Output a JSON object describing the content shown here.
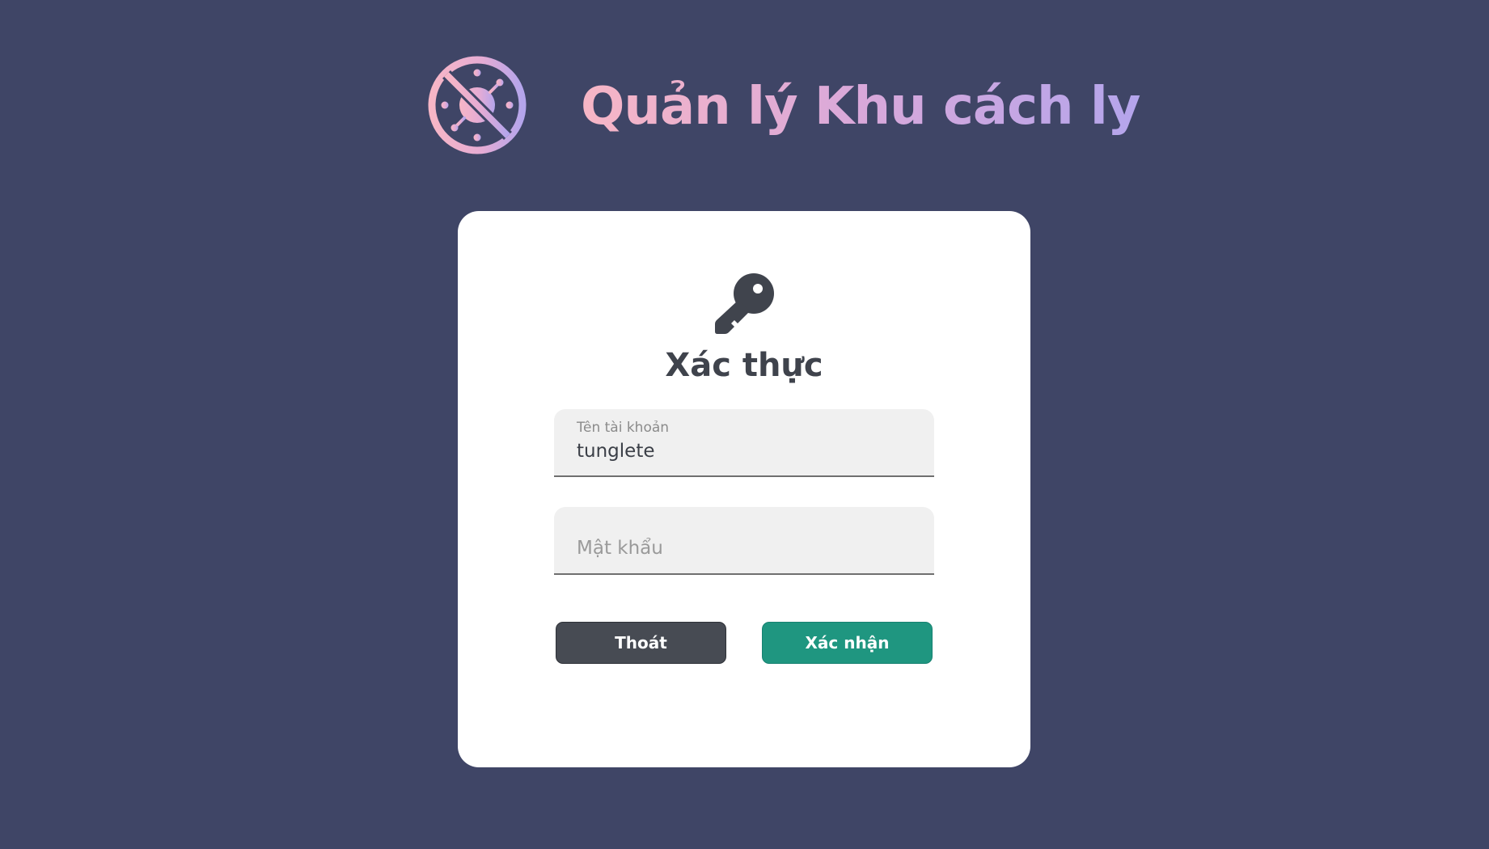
{
  "header": {
    "logo_icon": "no-virus-icon",
    "title": "Quản lý Khu cách ly",
    "title_gradient": [
      "#f7b6c6",
      "#d9a8da",
      "#b4a5ec"
    ]
  },
  "auth_card": {
    "icon": "key-icon",
    "title": "Xác thực",
    "username": {
      "label": "Tên tài khoản",
      "value": "tunglete"
    },
    "password": {
      "placeholder": "Mật khẩu",
      "value": ""
    },
    "buttons": {
      "exit_label": "Thoát",
      "confirm_label": "Xác nhận"
    }
  },
  "colors": {
    "background": "#3f4566",
    "card": "#ffffff",
    "exit_button": "#474b53",
    "confirm_button": "#1f9680",
    "title_text": "#3f434c"
  }
}
